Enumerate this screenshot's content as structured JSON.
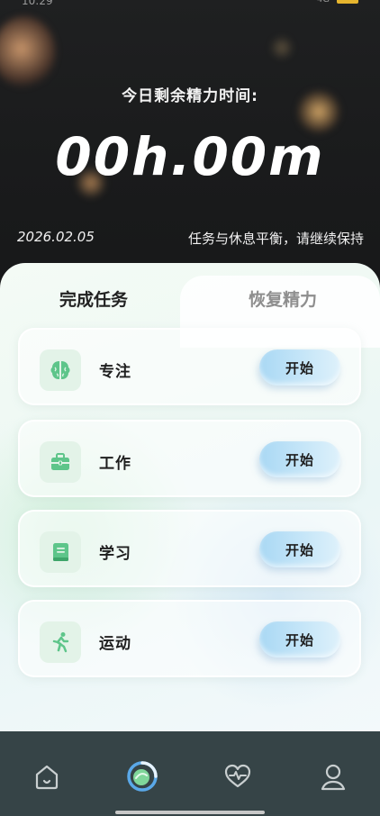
{
  "status_bar": {
    "time": "10:29",
    "signal": "4G",
    "battery_color": "#e6b52e"
  },
  "header": {
    "energy_label": "今日剩余精力时间:",
    "energy_time": "00h.00m",
    "date": "2026.02.05",
    "balance_message": "任务与休息平衡，请继续保持"
  },
  "tabs": [
    {
      "label": "完成任务",
      "active": true
    },
    {
      "label": "恢复精力",
      "active": false
    }
  ],
  "tasks": [
    {
      "label": "专注",
      "icon": "brain-icon",
      "button": "开始"
    },
    {
      "label": "工作",
      "icon": "briefcase-icon",
      "button": "开始"
    },
    {
      "label": "学习",
      "icon": "book-icon",
      "button": "开始"
    },
    {
      "label": "运动",
      "icon": "running-icon",
      "button": "开始"
    }
  ],
  "bottom_nav": [
    {
      "name": "home-icon",
      "active": false
    },
    {
      "name": "energy-icon",
      "active": true
    },
    {
      "name": "heart-rate-icon",
      "active": false
    },
    {
      "name": "profile-icon",
      "active": false
    }
  ],
  "colors": {
    "accent_green": "#5ec58a",
    "button_blue": "#a9d8f4",
    "nav_bg": "#364447",
    "header_bg": "#1d1e1f"
  }
}
